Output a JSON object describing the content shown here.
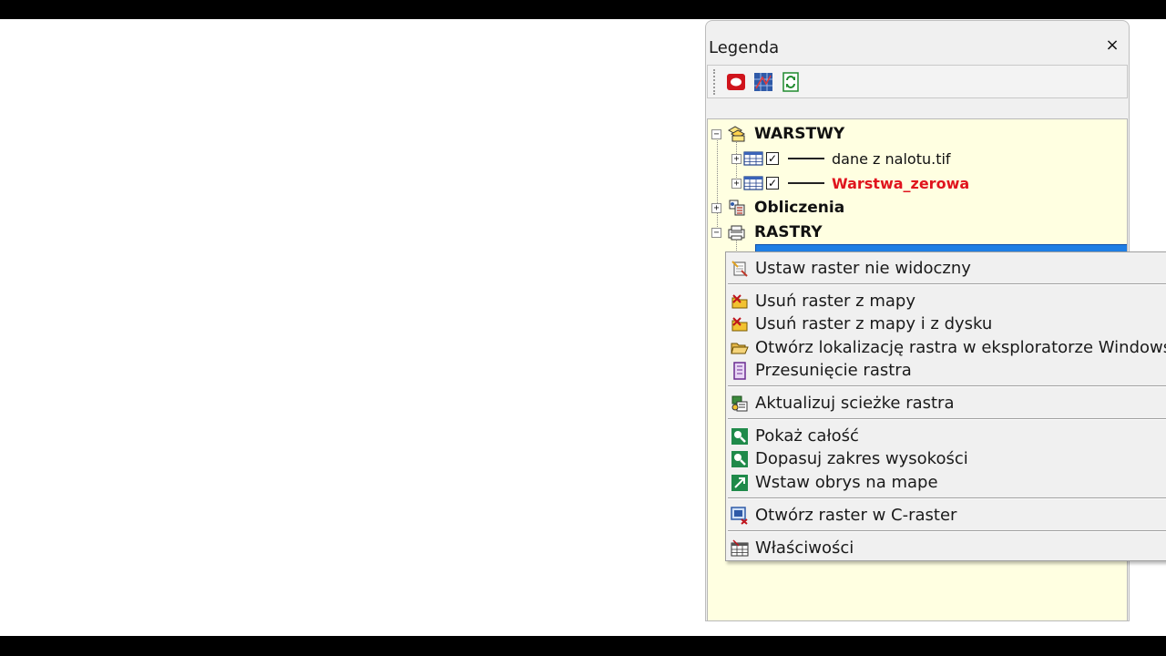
{
  "legend": {
    "title": "Legenda",
    "close_glyph": "×",
    "toolbar": [
      {
        "icon": "red-oval-icon",
        "color": "#d0141c"
      },
      {
        "icon": "map-grid-icon",
        "color": "#2f5aa8"
      },
      {
        "icon": "refresh-document-icon",
        "color": "#1f8a2e"
      }
    ],
    "tree": {
      "background": "#ffffe1",
      "groups": [
        {
          "label": "WARSTWY",
          "expander": "−",
          "icon": "layers-folder-icon",
          "layers": [
            {
              "expander": "+",
              "checked": "✓",
              "label": "dane z nalotu.tif",
              "color": "#111111"
            },
            {
              "expander": "+",
              "checked": "✓",
              "label": "Warstwa_zerowa",
              "color": "#e0141e"
            }
          ]
        },
        {
          "label": "Obliczenia",
          "expander": "+",
          "icon": "calculator-group-icon"
        },
        {
          "label": "RASTRY",
          "expander": "−",
          "icon": "raster-group-icon"
        }
      ]
    }
  },
  "context_menu": {
    "items": [
      {
        "label": "Ustaw raster nie widoczny",
        "icon": "hide-raster-icon"
      },
      {
        "label": "Usuń raster z mapy",
        "icon": "remove-from-map-icon"
      },
      {
        "label": "Usuń raster z mapy i z dysku",
        "icon": "delete-from-disk-icon"
      },
      {
        "label": "Otwórz lokalizację rastra w eksploratorze Windows",
        "icon": "open-folder-icon"
      },
      {
        "label": "Przesunięcie rastra",
        "icon": "shift-raster-icon"
      },
      {
        "label": "Aktualizuj scieżke rastra",
        "icon": "update-path-icon"
      },
      {
        "label": "Pokaż całość",
        "icon": "zoom-extent-icon"
      },
      {
        "label": "Dopasuj zakres wysokości",
        "icon": "fit-height-range-icon"
      },
      {
        "label": "Wstaw obrys na mape",
        "icon": "insert-outline-icon"
      },
      {
        "label": "Otwórz raster w C-raster",
        "icon": "open-c-raster-icon"
      },
      {
        "label": "Właściwości",
        "icon": "properties-icon"
      }
    ]
  },
  "colors": {
    "selection": "#1e7ee4",
    "panel": "#f0f0f0",
    "accent_red": "#e0141e"
  }
}
